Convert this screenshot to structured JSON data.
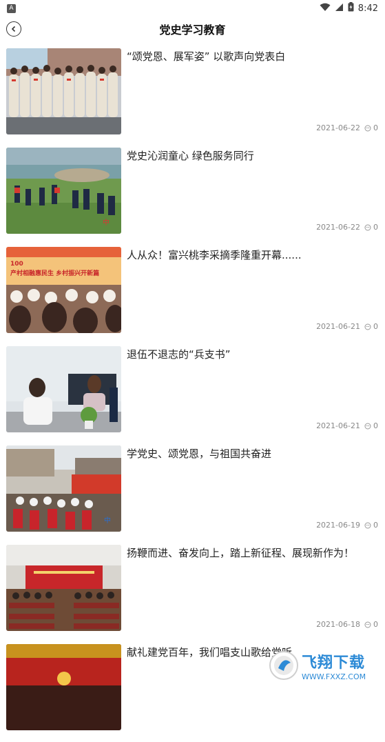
{
  "status_bar": {
    "app_icon_letter": "A",
    "time": "8:42"
  },
  "header": {
    "title": "党史学习教育"
  },
  "articles": [
    {
      "title": "“颂党恩、展军姿” 以歌声向党表白",
      "date": "2021-06-22",
      "comments": "0"
    },
    {
      "title": "党史沁润童心 绿色服务同行",
      "date": "2021-06-22",
      "comments": "0"
    },
    {
      "title": "人从众！富兴桃李采摘季隆重开幕......",
      "date": "2021-06-21",
      "comments": "0"
    },
    {
      "title": "退伍不退志的“兵支书”",
      "date": "2021-06-21",
      "comments": "0"
    },
    {
      "title": "学党史、颂党恩，与祖国共奋进",
      "date": "2021-06-19",
      "comments": "0"
    },
    {
      "title": "扬鞭而进、奋发向上，踏上新征程、展现新作为！",
      "date": "2021-06-18",
      "comments": "0"
    },
    {
      "title": "献礼建党百年，我们唱支山歌给党听",
      "date": "",
      "comments": ""
    }
  ],
  "thumb_captions": {
    "item3_banner": "产村相融惠民生 乡村振兴开新篇",
    "item3_logo": "100"
  },
  "watermark": {
    "title": "飞翔下载",
    "url": "WWW.FXXZ.COM"
  }
}
